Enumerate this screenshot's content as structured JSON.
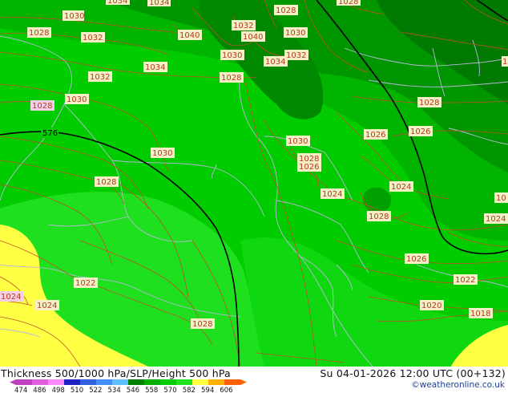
{
  "map": {
    "thickness_line_label": "576",
    "pressure_labels": [
      "1030",
      "1034",
      "1028",
      "1028",
      "1032",
      "1040",
      "1032",
      "1040",
      "1030",
      "1030",
      "1034",
      "1032",
      "1032",
      "1034",
      "1028",
      "1028",
      "1030",
      "1030",
      "1030",
      "1028",
      "1026",
      "1028",
      "1026",
      "1024",
      "1026",
      "1028",
      "1024",
      "1024",
      "1026",
      "1022",
      "1022",
      "1024",
      "1020",
      "1018",
      "1028"
    ],
    "colors": {
      "green_dark": "#008000",
      "green_mid": "#00b000",
      "green_light": "#00cc00",
      "green_bright": "#1ee01e",
      "yellow": "#ffff44",
      "isobar": "#c0502a",
      "thickness_line": "#000000",
      "border": "#b8b8d8"
    }
  },
  "footer": {
    "title": "Thickness 500/1000 hPa/SLP/Height 500 hPa",
    "valid": "Su 04-01-2026 12:00 UTC (00+132)",
    "credit": "©weatheronline.co.uk",
    "colorbar_ticks": [
      "474",
      "486",
      "498",
      "510",
      "522",
      "534",
      "546",
      "558",
      "570",
      "582",
      "594",
      "606"
    ],
    "colorbar_colors": [
      "#c040c0",
      "#e060e0",
      "#ff88ff",
      "#2020c0",
      "#3060e0",
      "#4090ff",
      "#60c0ff",
      "#008000",
      "#00b000",
      "#00cc00",
      "#20e020",
      "#ffff44",
      "#ffb000",
      "#ff6000"
    ]
  }
}
